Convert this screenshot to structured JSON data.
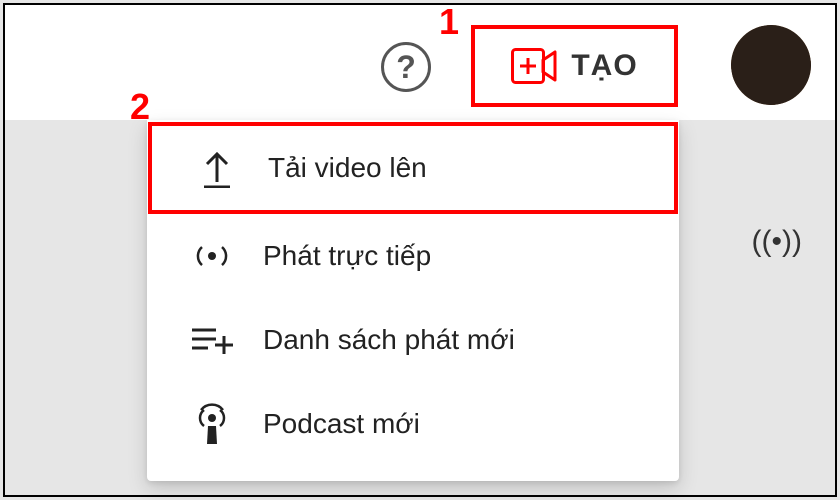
{
  "annotations": {
    "callout1": "1",
    "callout2": "2"
  },
  "header": {
    "create_button_label": "TẠO"
  },
  "help": {
    "symbol": "?"
  },
  "dropdown": {
    "items": [
      {
        "label": "Tải video lên"
      },
      {
        "label": "Phát trực tiếp"
      },
      {
        "label": "Danh sách phát mới"
      },
      {
        "label": "Podcast mới"
      }
    ]
  },
  "background": {
    "antenna": "((•))"
  }
}
